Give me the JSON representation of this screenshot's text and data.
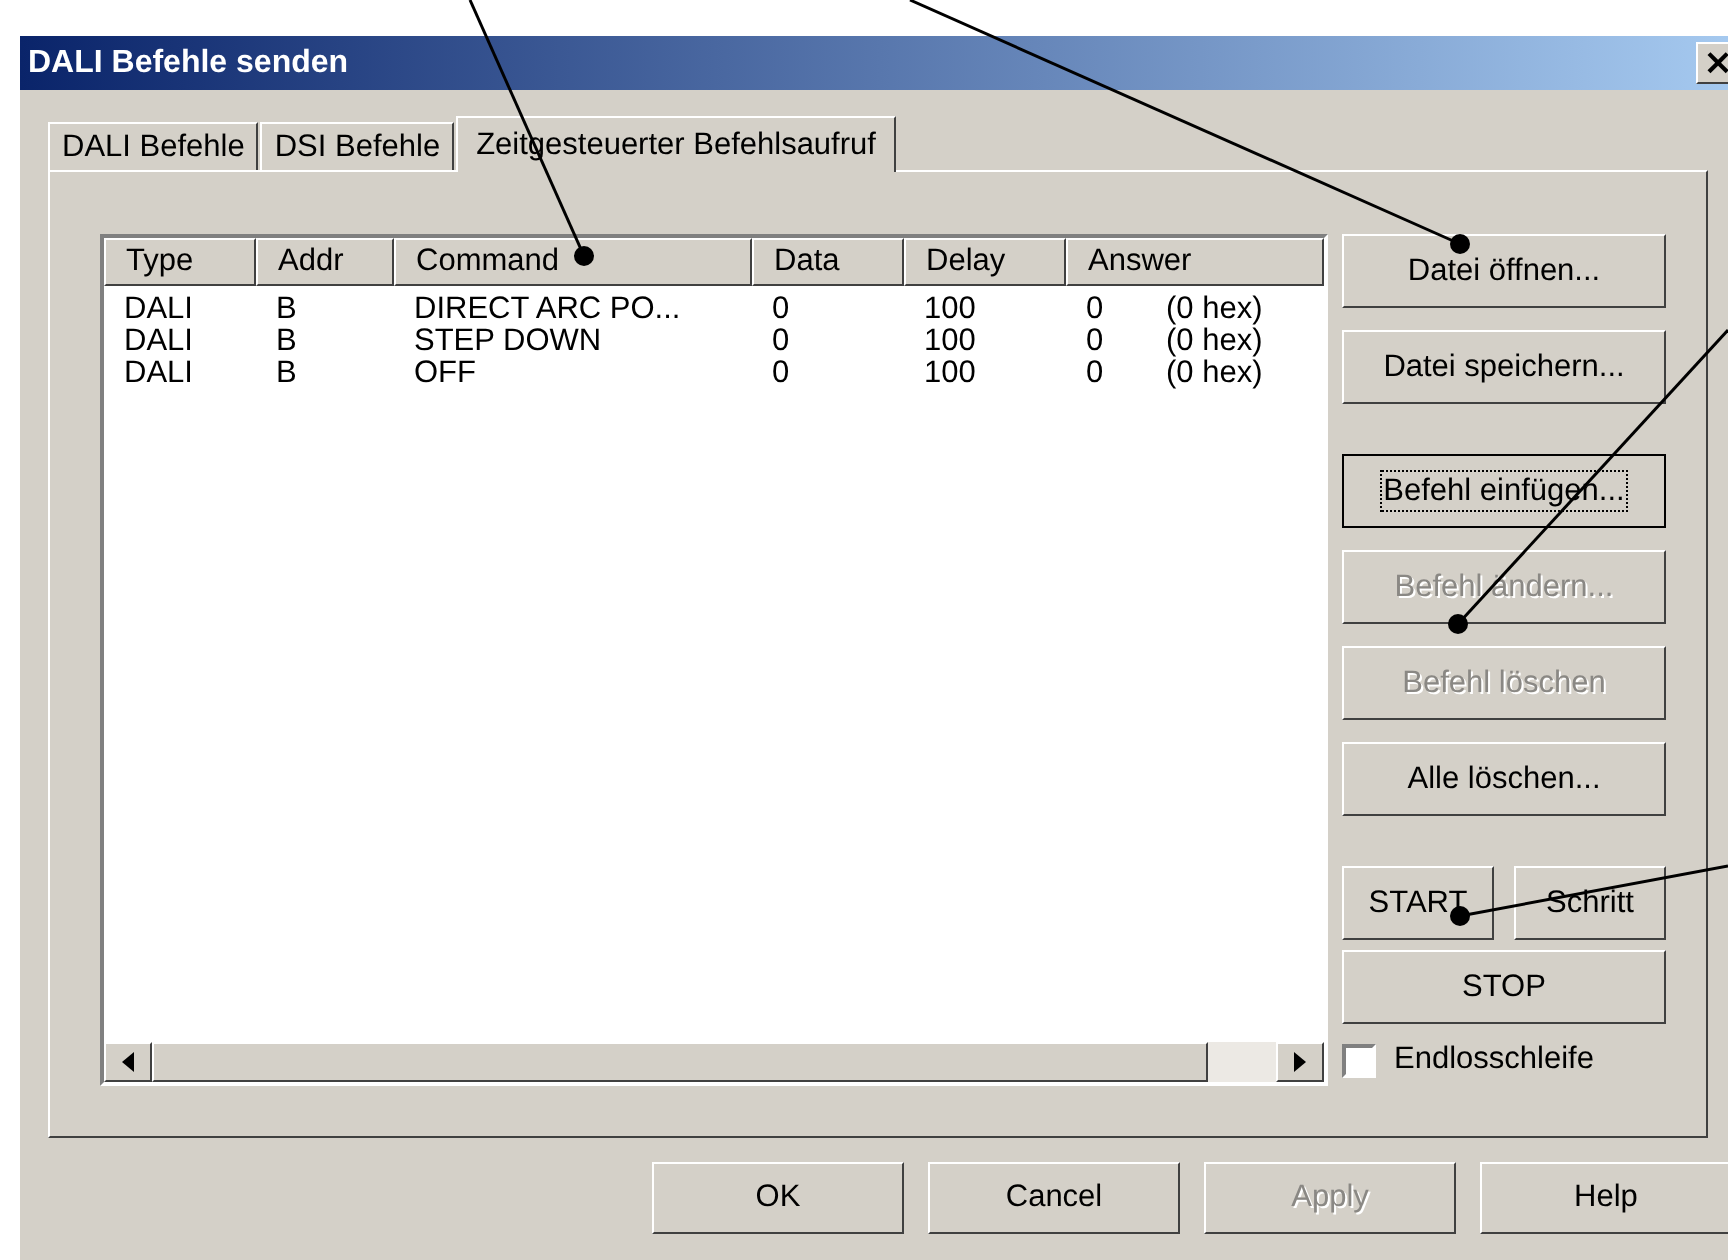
{
  "window": {
    "title": "DALI Befehle senden",
    "close": "×"
  },
  "tabs": [
    {
      "label": "DALI Befehle",
      "selected": false
    },
    {
      "label": "DSI Befehle",
      "selected": false
    },
    {
      "label": "Zeitgesteuerter Befehlsaufruf",
      "selected": true
    }
  ],
  "table": {
    "columns": [
      "Type",
      "Addr",
      "Command",
      "Data",
      "Delay",
      "Answer"
    ],
    "rows": [
      {
        "type": "DALI",
        "addr": "B",
        "command": "DIRECT ARC PO...",
        "data": "0",
        "delay": "100",
        "answer": "0",
        "answer_hex": "(0 hex)"
      },
      {
        "type": "DALI",
        "addr": "B",
        "command": "STEP DOWN",
        "data": "0",
        "delay": "100",
        "answer": "0",
        "answer_hex": "(0 hex)"
      },
      {
        "type": "DALI",
        "addr": "B",
        "command": "OFF",
        "data": "0",
        "delay": "100",
        "answer": "0",
        "answer_hex": "(0 hex)"
      }
    ]
  },
  "side_panel": {
    "file_buttons": [
      {
        "label": "Datei öffnen...",
        "disabled": false,
        "focused": false
      },
      {
        "label": "Datei speichern...",
        "disabled": false,
        "focused": false
      }
    ],
    "edit_buttons": [
      {
        "label": "Befehl einfügen...",
        "disabled": false,
        "focused": true
      },
      {
        "label": "Befehl ändern...",
        "disabled": true,
        "focused": false
      },
      {
        "label": "Befehl löschen",
        "disabled": true,
        "focused": false
      },
      {
        "label": "Alle löschen...",
        "disabled": false,
        "focused": false
      }
    ],
    "run_buttons": [
      {
        "label": "START",
        "disabled": false,
        "focused": false
      },
      {
        "label": "Schritt",
        "disabled": false,
        "focused": false
      }
    ],
    "stop_button": {
      "label": "STOP",
      "disabled": false,
      "focused": false
    },
    "loop_checkbox": {
      "label": "Endlosschleife",
      "checked": false
    }
  },
  "dialog_buttons": [
    {
      "label": "OK",
      "disabled": false
    },
    {
      "label": "Cancel",
      "disabled": false
    },
    {
      "label": "Apply",
      "disabled": true
    },
    {
      "label": "Help",
      "disabled": false
    }
  ]
}
